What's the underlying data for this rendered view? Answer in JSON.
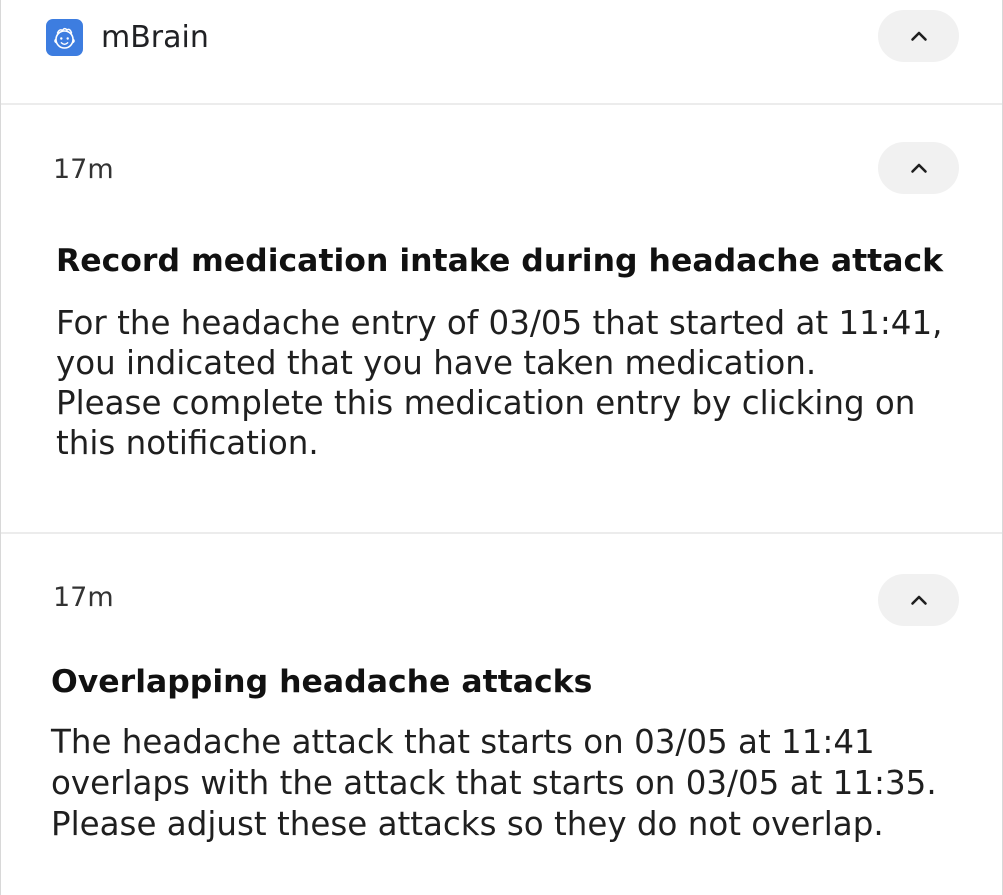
{
  "app": {
    "name": "mBrain",
    "icon": "mbrain-app-icon"
  },
  "header": {
    "collapse_icon": "chevron-up-icon"
  },
  "notifications": [
    {
      "time": "17m",
      "title": "Record medication intake during headache attack",
      "body": "For the headache entry of 03/05 that started at 11:41,\nyou indicated that you have taken medication.\nPlease complete this medication entry by clicking on\nthis notification.",
      "collapse_icon": "chevron-up-icon"
    },
    {
      "time": "17m",
      "title": "Overlapping headache attacks",
      "body": "The headache attack that starts on 03/05 at 11:41\noverlaps with the attack that starts on 03/05 at 11:35.\nPlease adjust these attacks so they do not overlap.",
      "collapse_icon": "chevron-up-icon"
    }
  ],
  "colors": {
    "app_icon_bg": "#3d7de0",
    "button_bg": "#f1f1f1",
    "divider": "#ececec",
    "text": "#1f1f1f"
  }
}
